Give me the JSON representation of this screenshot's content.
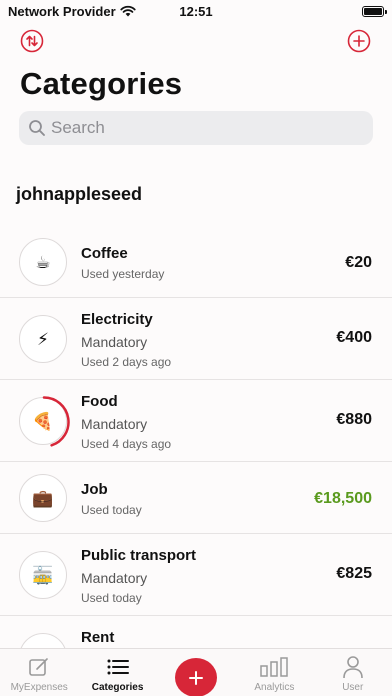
{
  "status_bar": {
    "carrier": "Network Provider",
    "time": "12:51"
  },
  "header": {
    "sort_icon": "sort-arrows-icon",
    "add_icon": "add-circle-icon",
    "title": "Categories"
  },
  "search": {
    "placeholder": "Search",
    "value": ""
  },
  "section": {
    "title": "johnappleseed"
  },
  "categories": [
    {
      "name": "Coffee",
      "subtitle": "",
      "used": "Used yesterday",
      "amount": "€20",
      "icon": "coffee-cup-icon",
      "glyph": "☕"
    },
    {
      "name": "Electricity",
      "subtitle": "Mandatory",
      "used": "Used 2 days ago",
      "amount": "€400",
      "icon": "lightning-icon",
      "glyph": "⚡"
    },
    {
      "name": "Food",
      "subtitle": "Mandatory",
      "used": "Used 4 days ago",
      "amount": "€880",
      "icon": "pizza-icon",
      "glyph": "🍕",
      "progress": 0.45
    },
    {
      "name": "Job",
      "subtitle": "",
      "used": "Used today",
      "amount": "€18,500",
      "icon": "briefcase-icon",
      "glyph": "💼"
    },
    {
      "name": "Public transport",
      "subtitle": "Mandatory",
      "used": "Used today",
      "amount": "€825",
      "icon": "tram-icon",
      "glyph": "🚋"
    },
    {
      "name": "Rent",
      "subtitle": "",
      "used": "",
      "amount": "",
      "icon": "house-icon",
      "glyph": ""
    }
  ],
  "colors": {
    "accent": "#d72638",
    "positive": "#5a9a1e"
  },
  "tabbar": {
    "tabs": [
      {
        "label": "MyExpenses",
        "icon": "edit-square-icon"
      },
      {
        "label": "Categories",
        "icon": "list-icon"
      },
      {
        "label": "",
        "icon": "plus-icon"
      },
      {
        "label": "Analytics",
        "icon": "bar-chart-icon"
      },
      {
        "label": "User",
        "icon": "person-icon"
      }
    ]
  }
}
